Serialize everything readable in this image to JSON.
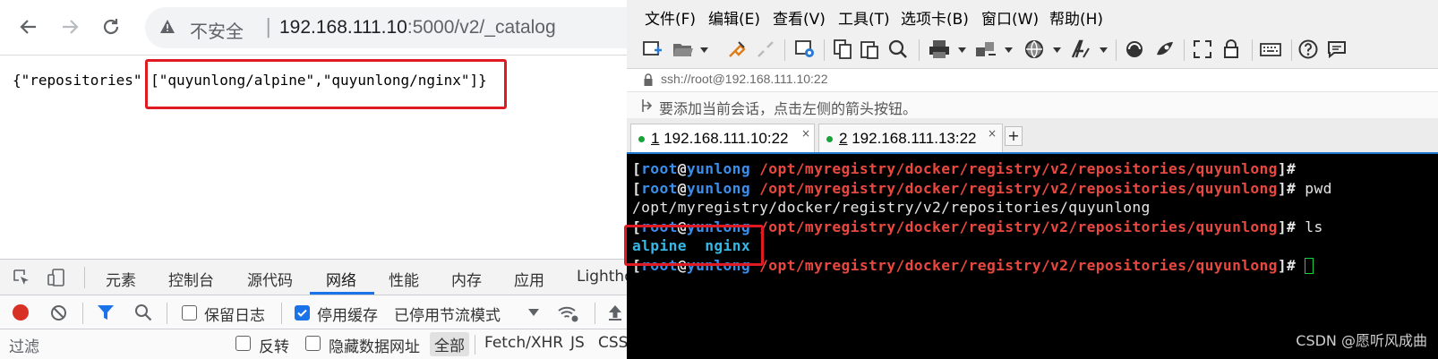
{
  "browser": {
    "insecure_label": "不安全",
    "separator": "|",
    "url_host": "192.168.111.10",
    "url_path": ":5000/v2/_catalog",
    "json_prefix": "{\"repositories\":",
    "json_array": "[\"quyunlong/alpine\",\"quyunlong/nginx\"]}",
    "highlight_color": "#e01a22"
  },
  "devtools": {
    "tabs": [
      "元素",
      "控制台",
      "源代码",
      "网络",
      "性能",
      "内存",
      "应用",
      "Lighthouse"
    ],
    "active_tab": "网络",
    "preserve_log_label": "保留日志",
    "disable_cache_label": "停用缓存",
    "throttle_label": "已停用节流模式",
    "filter_placeholder": "过滤",
    "invert_label": "反转",
    "hide_data_urls_label": "隐藏数据网址",
    "all_label": "全部",
    "fetch_xhr_label": "Fetch/XHR",
    "js_label": "JS",
    "css_label": "CSS",
    "accent_color": "#1a73e8"
  },
  "xshell": {
    "menu": [
      "文件(F)",
      "编辑(E)",
      "查看(V)",
      "工具(T)",
      "选项卡(B)",
      "窗口(W)",
      "帮助(H)"
    ],
    "session_address": "ssh://root@192.168.111.10:22",
    "hint_text": "要添加当前会话，点击左侧的箭头按钮。",
    "tabs": [
      {
        "index": "1",
        "label": "192.168.111.10:22",
        "active": true
      },
      {
        "index": "2",
        "label": "192.168.111.13:22",
        "active": false
      }
    ],
    "add_tab": "+",
    "close_glyph": "×"
  },
  "terminal": {
    "user": "root",
    "at": "@",
    "host": "yunlong",
    "cwd": "/opt/myregistry/docker/registry/v2/repositories/quyunlong",
    "lines": [
      {
        "cmd": ""
      },
      {
        "cmd": " pwd"
      },
      {
        "output": "/opt/myregistry/docker/registry/v2/repositories/quyunlong"
      },
      {
        "cmd": " ls"
      },
      {
        "listing": [
          "alpine",
          "nginx"
        ]
      },
      {
        "cmd": " "
      }
    ]
  },
  "watermark": "CSDN @愿听风成曲"
}
